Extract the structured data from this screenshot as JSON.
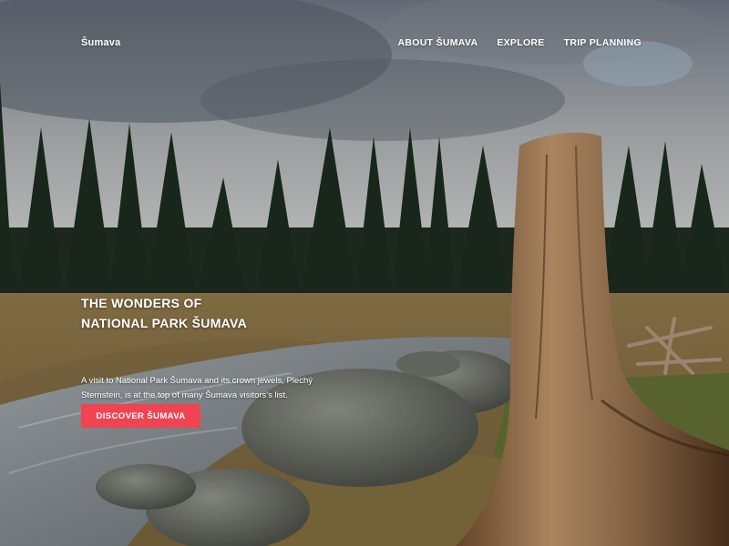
{
  "header": {
    "logo": "Šumava",
    "nav": [
      "ABOUT ŠUMAVA",
      "EXPLORE",
      "TRIP PLANNING"
    ]
  },
  "hero": {
    "headline_line1": "THE WONDERS OF",
    "headline_line2": "NATIONAL PARK ŠUMAVA",
    "description": "A visit to National Park Šumava and its crown jewels, Plechý Sternstein, is at the top of many Šumava visitors's list.",
    "cta_label": "DISCOVER ŠUMAVA",
    "background": "forest-river-landscape-photo"
  },
  "colors": {
    "accent": "#f04452",
    "text": "#ffffff"
  }
}
